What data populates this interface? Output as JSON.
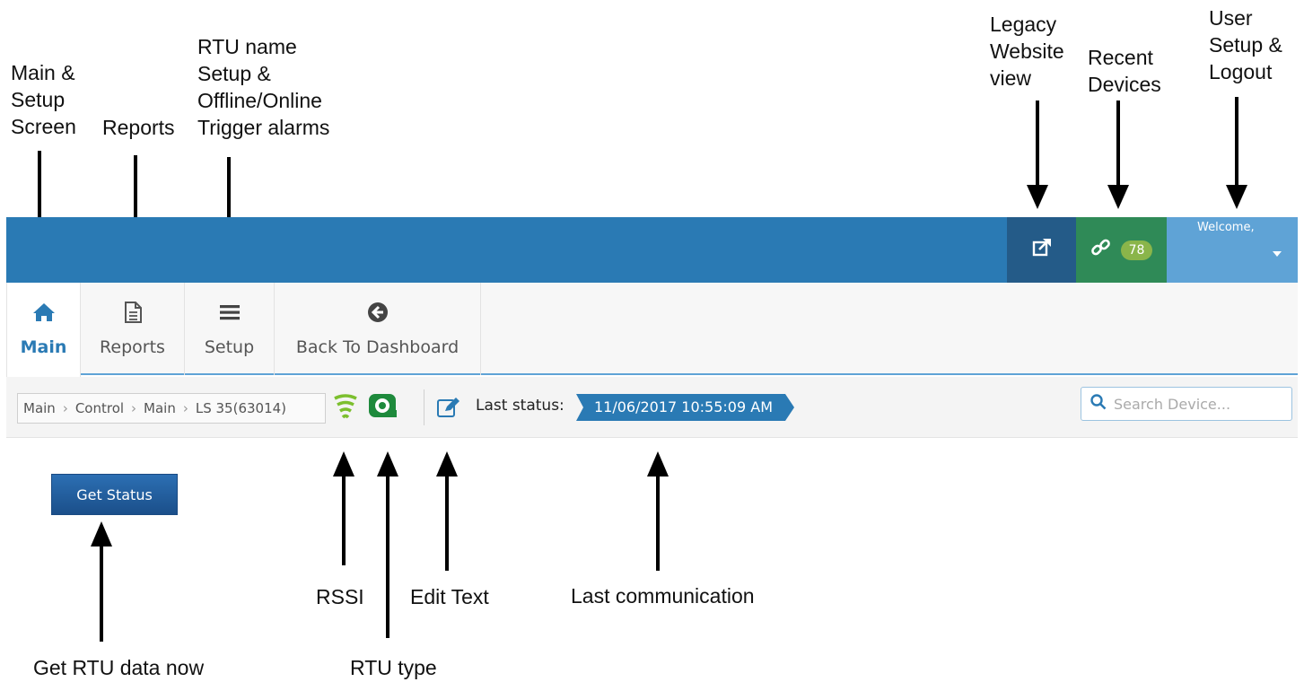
{
  "annotations": {
    "main_setup": "Main &\nSetup\nScreen",
    "reports": "Reports",
    "rtu_name": "RTU name\nSetup &\nOffline/Online\nTrigger alarms",
    "legacy": "Legacy\nWebsite\nview",
    "recent": "Recent\nDevices",
    "user": "User\nSetup &\nLogout",
    "rssi": "RSSI",
    "edit_text": "Edit Text",
    "last_comm": "Last communication",
    "get_rtu": "Get RTU data now",
    "rtu_type": "RTU type"
  },
  "header": {
    "recent_count": "78",
    "welcome": "Welcome,"
  },
  "tabs": {
    "main": "Main",
    "reports": "Reports",
    "setup": "Setup",
    "back": "Back To Dashboard"
  },
  "breadcrumb": [
    "Main",
    "Control",
    "Main",
    "LS 35(63014)"
  ],
  "status": {
    "label": "Last status:",
    "value": "11/06/2017 10:55:09 AM"
  },
  "search": {
    "placeholder": "Search Device..."
  },
  "actions": {
    "get_status": "Get Status"
  },
  "colors": {
    "topbar": "#2a7ab4",
    "legacy": "#245b88",
    "recent": "#2f8a57",
    "user": "#5fa3d6",
    "badge": "#8ab54a",
    "rssi": "#7cbf2e",
    "rtu_type": "#1e8a3c"
  },
  "icons": {
    "legacy": "external-link-icon",
    "recent": "link-icon",
    "main": "home-icon",
    "reports": "document-icon",
    "setup": "menu-icon",
    "back": "arrow-circle-left-icon",
    "rssi": "signal-icon",
    "rtu_type": "rtu-type-icon",
    "edit": "edit-icon",
    "search": "search-icon"
  }
}
